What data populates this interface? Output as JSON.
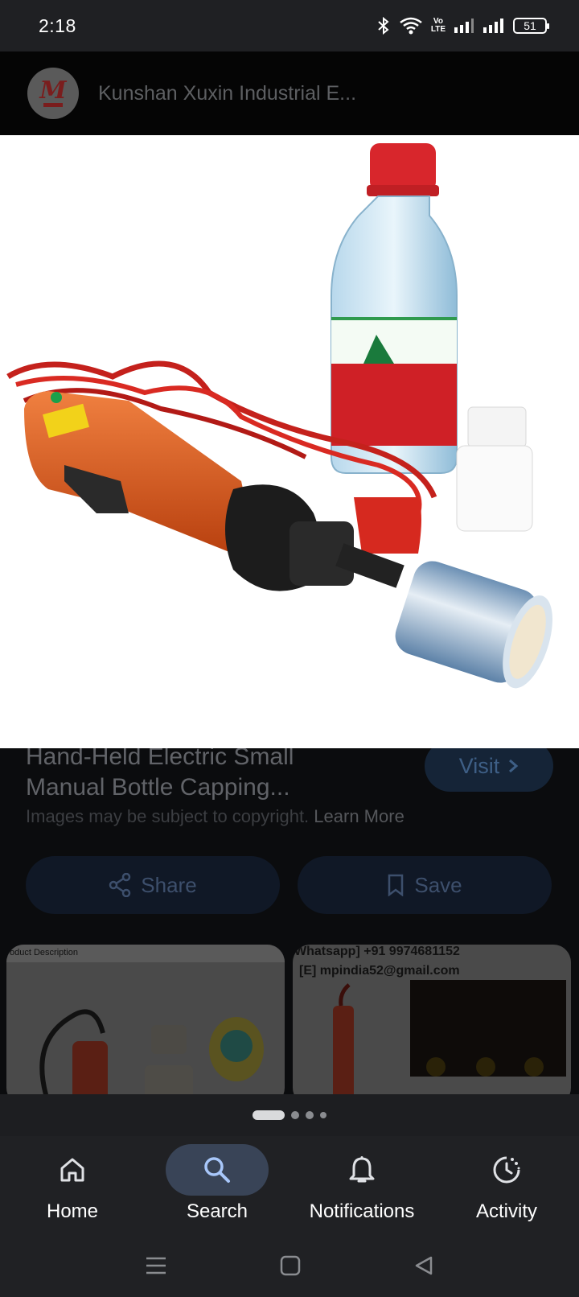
{
  "status_bar": {
    "time": "2:18",
    "volte_line1": "Vo",
    "volte_line2": "LTE",
    "battery": "51"
  },
  "site": {
    "name": "Kunshan Xuxin Industrial E...",
    "logo_letter": "M"
  },
  "product": {
    "title_line1": "Hand-Held Electric Small",
    "title_line2": "Manual Bottle Capping...",
    "visit_label": "Visit",
    "copyright_text": "Images may be subject to copyright.",
    "learn_more": "Learn More"
  },
  "actions": {
    "share_label": "Share",
    "save_label": "Save"
  },
  "thumbnails": {
    "left_caption": "oduct Description",
    "right_line1": "Whatsapp] +91 9974681152",
    "right_line2": "[E] mpindia52@gmail.com"
  },
  "bottom_nav": {
    "items": [
      {
        "label": "Home",
        "icon": "home-icon"
      },
      {
        "label": "Search",
        "icon": "search-icon",
        "active": true
      },
      {
        "label": "Notifications",
        "icon": "bell-icon"
      },
      {
        "label": "Activity",
        "icon": "activity-icon"
      }
    ]
  },
  "colors": {
    "accent": "#394457",
    "background": "#0c0d0f",
    "nav_background": "#202124"
  }
}
